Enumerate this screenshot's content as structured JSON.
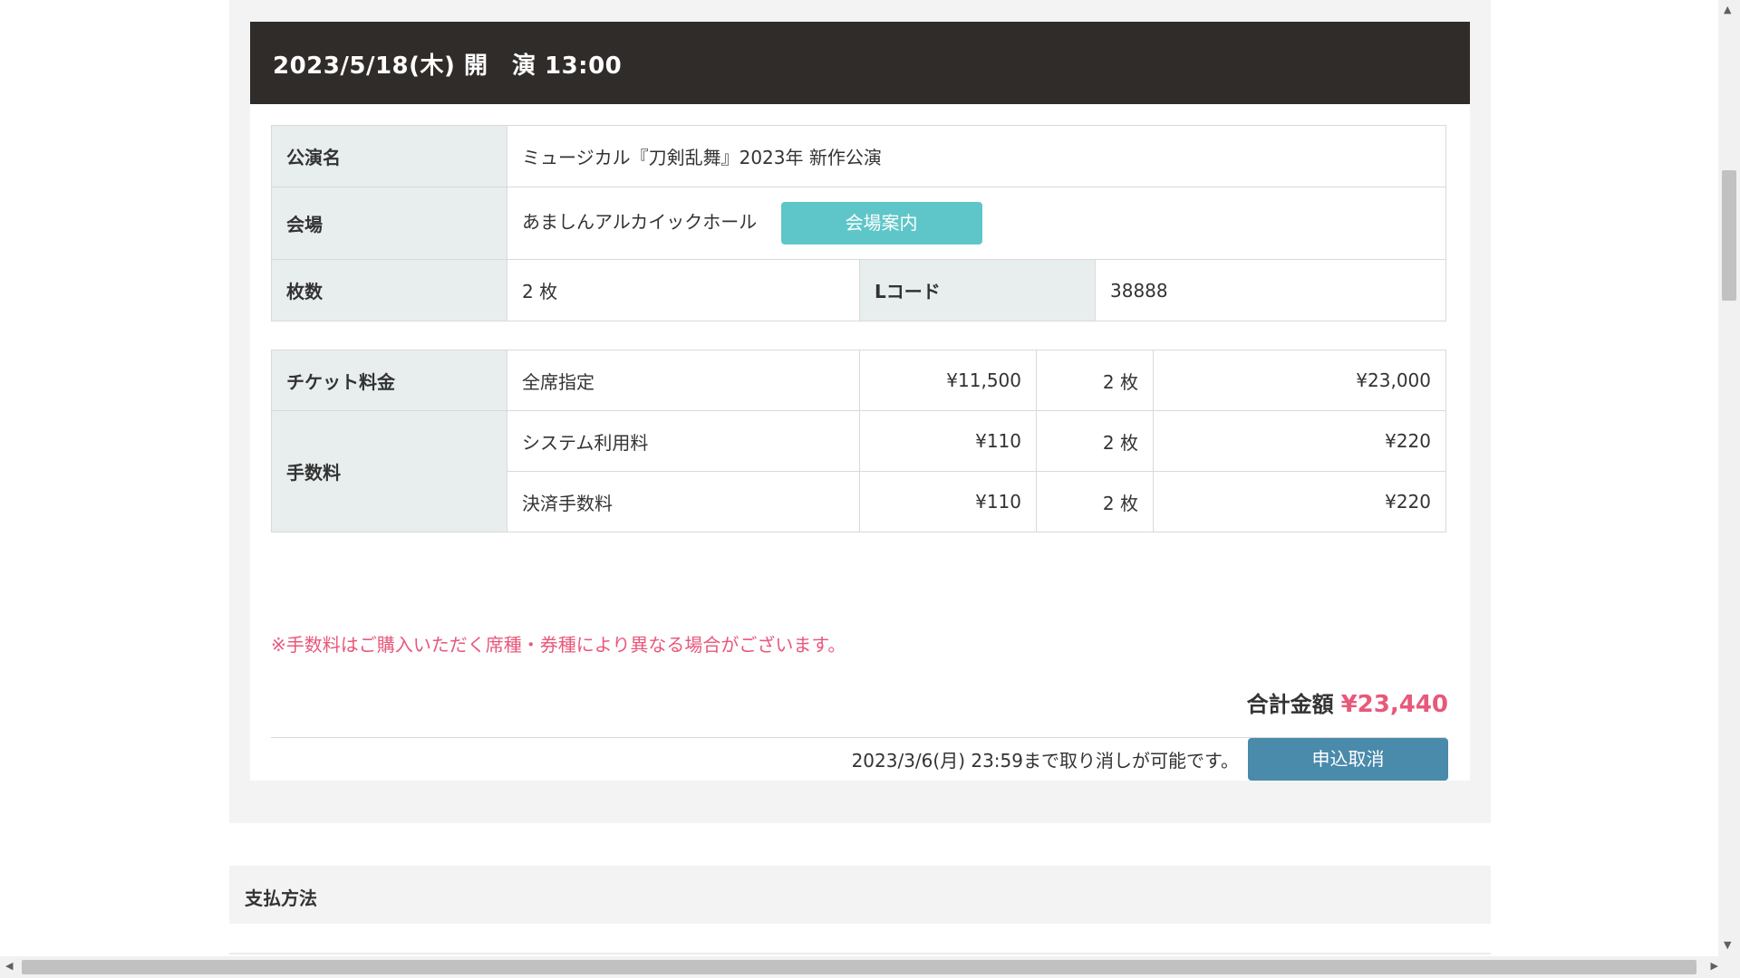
{
  "header": {
    "date": "2023/5/18(木) 開　演 13:00"
  },
  "info": {
    "performance_label": "公演名",
    "performance_value": "ミュージカル『刀剣乱舞』2023年 新作公演",
    "venue_label": "会場",
    "venue_value": "あましんアルカイックホール",
    "venue_button": "会場案内",
    "count_label": "枚数",
    "count_value": "2 枚",
    "lcode_label": "Lコード",
    "lcode_value": "38888"
  },
  "price": {
    "ticket_label": "チケット料金",
    "fee_label": "手数料",
    "rows": [
      {
        "name": "全席指定",
        "unit": "¥11,500",
        "qty": "2 枚",
        "subtotal": "¥23,000"
      },
      {
        "name": "システム利用料",
        "unit": "¥110",
        "qty": "2 枚",
        "subtotal": "¥220"
      },
      {
        "name": "決済手数料",
        "unit": "¥110",
        "qty": "2 枚",
        "subtotal": "¥220"
      }
    ]
  },
  "note": "※手数料はご購入いただく席種・券種により異なる場合がございます。",
  "total": {
    "label": "合計金額",
    "amount": "¥23,440"
  },
  "cancel": {
    "deadline": "2023/3/6(月) 23:59まで取り消しが可能です。",
    "button": "申込取消"
  },
  "payment": {
    "label": "支払方法"
  },
  "colors": {
    "header_bg": "#302c2a",
    "accent_teal": "#5ec6c8",
    "accent_pink": "#e8587a",
    "button_blue": "#4a8aab"
  }
}
